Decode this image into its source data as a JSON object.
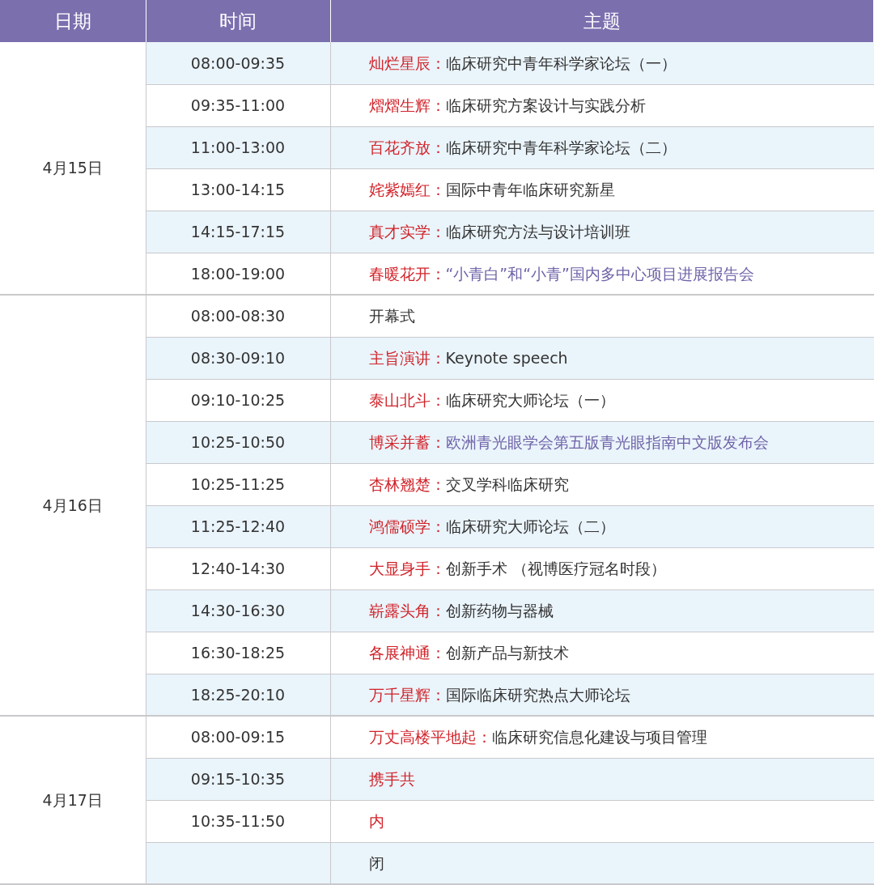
{
  "columns": [
    "日期",
    "时间",
    "主题"
  ],
  "days": [
    {
      "date": "4月15日",
      "sessions": [
        {
          "time": "08:00-09:35",
          "title": "灿烂星辰：",
          "description": "临床研究中青年科学家论坛（一）",
          "shaded": true
        },
        {
          "time": "09:35-11:00",
          "title": "熠熠生辉：",
          "description": "临床研究方案设计与实践分析",
          "shaded": false
        },
        {
          "time": "11:00-13:00",
          "title": "百花齐放：",
          "description": "临床研究中青年科学家论坛（二）",
          "shaded": true
        },
        {
          "time": "13:00-14:15",
          "title": "姹紫嫣红：",
          "description": "国际中青年临床研究新星",
          "shaded": false
        },
        {
          "time": "14:15-17:15",
          "title": "真才实学：",
          "description": "临床研究方法与设计培训班",
          "shaded": true
        },
        {
          "time": "18:00-19:00",
          "title": "春暖花开：",
          "description": "“小青白”和“小青”国内多中心项目进展报告会",
          "highlighted": true,
          "shaded": false
        }
      ]
    },
    {
      "date": "4月16日",
      "sessions": [
        {
          "time": "08:00-08:30",
          "description": "开幕式",
          "shaded": false
        },
        {
          "time": "08:30-09:10",
          "title": "主旨演讲：",
          "description": "Keynote speech",
          "shaded": true
        },
        {
          "time": "09:10-10:25",
          "title": "泰山北斗：",
          "description": "临床研究大师论坛（一）",
          "shaded": false
        },
        {
          "time": "10:25-10:50",
          "title": "博采并蓄：",
          "description": "欧洲青光眼学会第五版青光眼指南中文版发布会",
          "highlighted": true,
          "shaded": true
        },
        {
          "time": "10:25-11:25",
          "title": "杏林翘楚：",
          "description": "交叉学科临床研究",
          "shaded": false
        },
        {
          "time": "11:25-12:40",
          "title": "鸿儒硕学：",
          "description": "临床研究大师论坛（二）",
          "shaded": true
        },
        {
          "time": "12:40-14:30",
          "title": "大显身手：",
          "description": "创新手术 （视博医疗冠名时段）",
          "shaded": false
        },
        {
          "time": "14:30-16:30",
          "title": "崭露头角：",
          "description": "创新药物与器械",
          "shaded": true
        },
        {
          "time": "16:30-18:25",
          "title": "各展神通：",
          "description": "创新产品与新技术",
          "shaded": false
        },
        {
          "time": "18:25-20:10",
          "title": "万千星辉：",
          "description": "国际临床研究热点大师论坛",
          "shaded": true
        }
      ]
    },
    {
      "date": "4月17日",
      "sessions": [
        {
          "time": "08:00-09:15",
          "title": "万丈高楼平地起：",
          "description": "临床研究信息化建设与项目管理",
          "shaded": false
        },
        {
          "time": "09:15-10:35",
          "title": "携手共",
          "shaded": true
        },
        {
          "time": "10:35-11:50",
          "title": "内",
          "shaded": false
        },
        {
          "description": "闭",
          "shaded": true
        }
      ]
    }
  ]
}
